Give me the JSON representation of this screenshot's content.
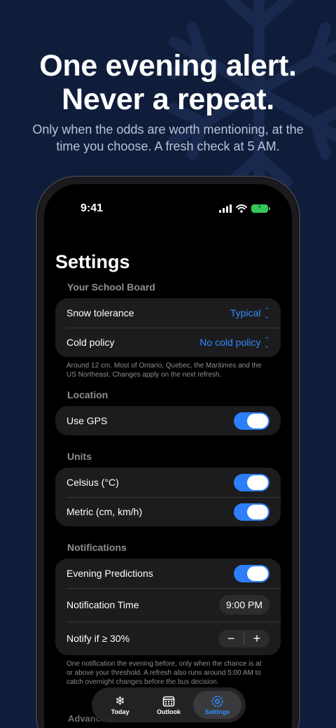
{
  "headline": {
    "line1": "One evening alert.",
    "line2": "Never a repeat.",
    "sub": "Only when the odds are worth mentioning, at the time you choose. A fresh check at 5 AM."
  },
  "status": {
    "time": "9:41"
  },
  "settings": {
    "title": "Settings",
    "board": {
      "label": "Your School Board",
      "snow_label": "Snow tolerance",
      "snow_value": "Typical",
      "cold_label": "Cold policy",
      "cold_value": "No cold policy",
      "note": "Around 12 cm. Most of Ontario, Quebec, the Maritimes and the US Northeast. Changes apply on the next refresh."
    },
    "location": {
      "label": "Location",
      "gps_label": "Use GPS",
      "gps_on": true
    },
    "units": {
      "label": "Units",
      "celsius_label": "Celsius (°C)",
      "celsius_on": true,
      "metric_label": "Metric (cm, km/h)",
      "metric_on": true
    },
    "notifications": {
      "label": "Notifications",
      "evening_label": "Evening Predictions",
      "evening_on": true,
      "time_label": "Notification Time",
      "time_value": "9:00 PM",
      "threshold_label": "Notify if ≥ 30%",
      "minus": "−",
      "plus": "+",
      "note": "One notification the evening before, only when the chance is at or above your threshold. A refresh also runs around 5:00 AM to catch overnight changes before the bus decision."
    },
    "advanced_label": "Advanced"
  },
  "tabs": [
    {
      "label": "Today",
      "icon": "snowflake-icon"
    },
    {
      "label": "Outlook",
      "icon": "calendar-icon"
    },
    {
      "label": "Settings",
      "icon": "gear-icon"
    }
  ],
  "colors": {
    "accent": "#2f8cff",
    "background": "#0f1d3b",
    "toggle_on": "#2d7ff9"
  }
}
